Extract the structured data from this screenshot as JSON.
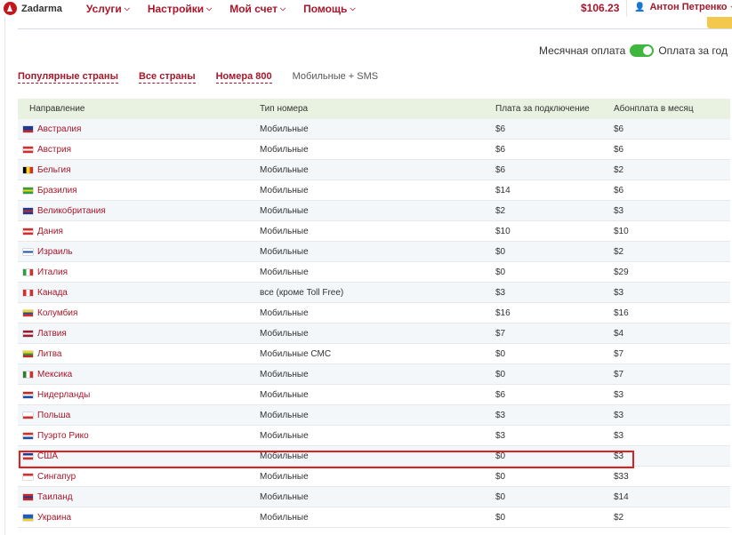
{
  "brand": {
    "name": "Zadarma"
  },
  "nav": {
    "items": [
      {
        "label": "Услуги"
      },
      {
        "label": "Настройки"
      },
      {
        "label": "Мой счет"
      },
      {
        "label": "Помощь"
      }
    ],
    "balance": "$106.23",
    "user": "Антон Петренко"
  },
  "billing_toggle": {
    "left_label": "Месячная оплата",
    "right_label": "Оплата за год",
    "state": "on"
  },
  "tabs": [
    {
      "label": "Популярные страны",
      "active": true
    },
    {
      "label": "Все страны",
      "active": true
    },
    {
      "label": "Номера 800",
      "active": true
    },
    {
      "label": "Мобильные + SMS",
      "active": false
    }
  ],
  "table": {
    "headers": [
      "Направление",
      "Тип номера",
      "Плата за подключение",
      "Абонплата в месяц"
    ],
    "highlighted_row": 16,
    "rows": [
      {
        "country": "Австралия",
        "type": "Мобильные",
        "setup": "$6",
        "monthly": "$6",
        "flag": [
          "#1f3a93",
          "#1f3a93",
          "#c62828"
        ]
      },
      {
        "country": "Австрия",
        "type": "Мобильные",
        "setup": "$6",
        "monthly": "$6",
        "flag": [
          "#d32f2f",
          "#ffffff",
          "#d32f2f"
        ]
      },
      {
        "country": "Бельгия",
        "type": "Мобильные",
        "setup": "$6",
        "monthly": "$2",
        "flag": [
          "#000000",
          "#f9d71c",
          "#d32f2f"
        ],
        "vertical": true
      },
      {
        "country": "Бразилия",
        "type": "Мобильные",
        "setup": "$14",
        "monthly": "$6",
        "flag": [
          "#2e9e3e",
          "#f3d21f",
          "#2e9e3e"
        ]
      },
      {
        "country": "Великобритания",
        "type": "Мобильные",
        "setup": "$2",
        "monthly": "$3",
        "flag": [
          "#1f3a93",
          "#c62828",
          "#1f3a93"
        ]
      },
      {
        "country": "Дания",
        "type": "Мобильные",
        "setup": "$10",
        "monthly": "$10",
        "flag": [
          "#d32f2f",
          "#ffffff",
          "#d32f2f"
        ]
      },
      {
        "country": "Израиль",
        "type": "Мобильные",
        "setup": "$0",
        "monthly": "$2",
        "flag": [
          "#ffffff",
          "#1e4fa3",
          "#ffffff"
        ]
      },
      {
        "country": "Италия",
        "type": "Мобильные",
        "setup": "$0",
        "monthly": "$29",
        "flag": [
          "#2e9e3e",
          "#ffffff",
          "#d32f2f"
        ],
        "vertical": true
      },
      {
        "country": "Канада",
        "type": "все (кроме Toll Free)",
        "setup": "$3",
        "monthly": "$3",
        "flag": [
          "#d32f2f",
          "#ffffff",
          "#d32f2f"
        ],
        "vertical": true
      },
      {
        "country": "Колумбия",
        "type": "Мобильные",
        "setup": "$16",
        "monthly": "$16",
        "flag": [
          "#f3d21f",
          "#1e4fa3",
          "#d32f2f"
        ]
      },
      {
        "country": "Латвия",
        "type": "Мобильные",
        "setup": "$7",
        "monthly": "$4",
        "flag": [
          "#9e1b32",
          "#ffffff",
          "#9e1b32"
        ]
      },
      {
        "country": "Литва",
        "type": "Мобильные СМС",
        "setup": "$0",
        "monthly": "$7",
        "flag": [
          "#f3d21f",
          "#2e9e3e",
          "#c62828"
        ]
      },
      {
        "country": "Мексика",
        "type": "Мобильные",
        "setup": "$0",
        "monthly": "$7",
        "flag": [
          "#2e7d32",
          "#ffffff",
          "#d32f2f"
        ],
        "vertical": true
      },
      {
        "country": "Нидерланды",
        "type": "Мобильные",
        "setup": "$6",
        "monthly": "$3",
        "flag": [
          "#c62828",
          "#ffffff",
          "#1e4fa3"
        ]
      },
      {
        "country": "Польша",
        "type": "Мобильные",
        "setup": "$3",
        "monthly": "$3",
        "flag": [
          "#ffffff",
          "#ffffff",
          "#d32f2f"
        ]
      },
      {
        "country": "Пуэрто Рико",
        "type": "Мобильные",
        "setup": "$3",
        "monthly": "$3",
        "flag": [
          "#d32f2f",
          "#ffffff",
          "#1e4fa3"
        ]
      },
      {
        "country": "США",
        "type": "Мобильные",
        "setup": "$0",
        "monthly": "$3",
        "flag": [
          "#1f3a93",
          "#ffffff",
          "#d32f2f"
        ]
      },
      {
        "country": "Сингапур",
        "type": "Мобильные",
        "setup": "$0",
        "monthly": "$33",
        "flag": [
          "#d32f2f",
          "#ffffff",
          "#ffffff"
        ]
      },
      {
        "country": "Таиланд",
        "type": "Мобильные",
        "setup": "$0",
        "monthly": "$14",
        "flag": [
          "#c62828",
          "#1f3a93",
          "#c62828"
        ]
      },
      {
        "country": "Украина",
        "type": "Мобильные",
        "setup": "$0",
        "monthly": "$2",
        "flag": [
          "#1e5bc6",
          "#1e5bc6",
          "#f3d21f"
        ]
      }
    ]
  }
}
